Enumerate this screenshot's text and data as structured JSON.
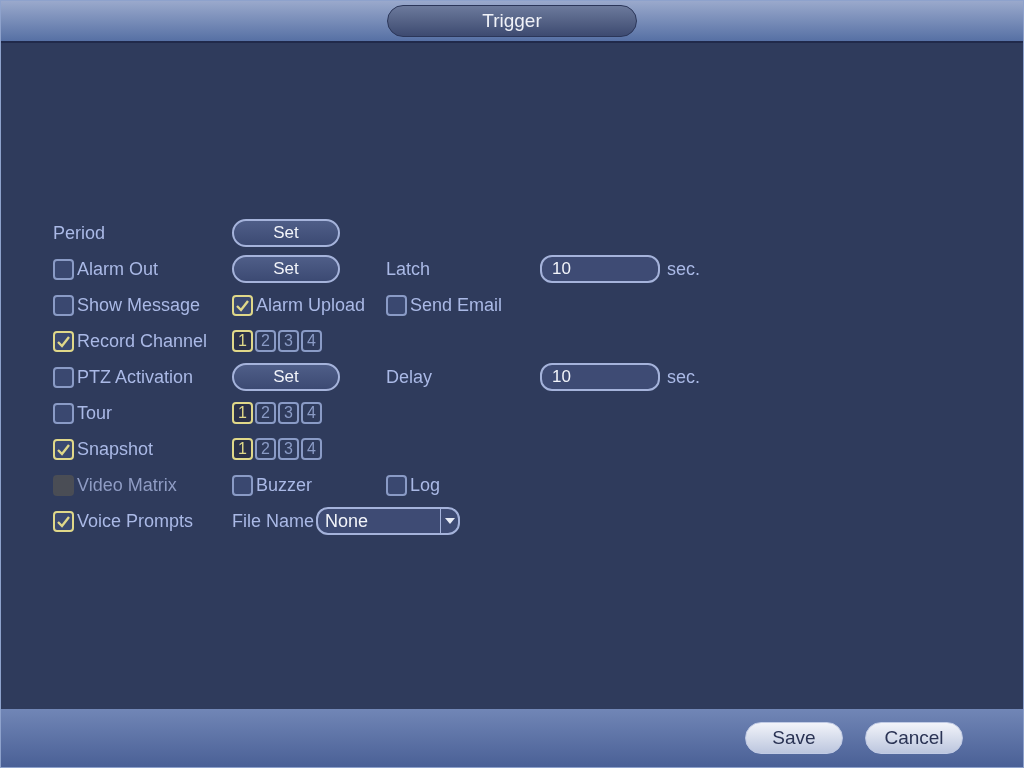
{
  "title": "Trigger",
  "rows": [
    {
      "items": [
        {
          "kind": "label",
          "text": "Period"
        },
        {
          "kind": "button",
          "text": "Set"
        }
      ]
    },
    {
      "items": [
        {
          "kind": "checkbox",
          "text": "Alarm Out",
          "checked": false,
          "disabled": false
        },
        {
          "kind": "button",
          "text": "Set"
        },
        {
          "kind": "label",
          "text": "Latch"
        },
        {
          "kind": "field",
          "value": "10",
          "unit": "sec."
        }
      ]
    },
    {
      "items": [
        {
          "kind": "checkbox",
          "text": "Show Message",
          "checked": false,
          "disabled": false
        },
        {
          "kind": "checkbox",
          "text": "Alarm Upload",
          "checked": true,
          "disabled": false
        },
        {
          "kind": "checkbox",
          "text": "Send Email",
          "checked": false,
          "disabled": false
        }
      ]
    },
    {
      "items": [
        {
          "kind": "checkbox",
          "text": "Record Channel",
          "checked": true,
          "disabled": false
        },
        {
          "kind": "channels",
          "channels": [
            {
              "text": "1",
              "selected": true
            },
            {
              "text": "2",
              "selected": false
            },
            {
              "text": "3",
              "selected": false
            },
            {
              "text": "4",
              "selected": false
            }
          ]
        }
      ]
    },
    {
      "items": [
        {
          "kind": "checkbox",
          "text": "PTZ Activation",
          "checked": false,
          "disabled": false
        },
        {
          "kind": "button",
          "text": "Set"
        },
        {
          "kind": "label",
          "text": "Delay"
        },
        {
          "kind": "field",
          "value": "10",
          "unit": "sec."
        }
      ]
    },
    {
      "items": [
        {
          "kind": "checkbox",
          "text": "Tour",
          "checked": false,
          "disabled": false
        },
        {
          "kind": "channels",
          "channels": [
            {
              "text": "1",
              "selected": true
            },
            {
              "text": "2",
              "selected": false
            },
            {
              "text": "3",
              "selected": false
            },
            {
              "text": "4",
              "selected": false
            }
          ]
        }
      ]
    },
    {
      "items": [
        {
          "kind": "checkbox",
          "text": "Snapshot",
          "checked": true,
          "disabled": false
        },
        {
          "kind": "channels",
          "channels": [
            {
              "text": "1",
              "selected": true
            },
            {
              "text": "2",
              "selected": false
            },
            {
              "text": "3",
              "selected": false
            },
            {
              "text": "4",
              "selected": false
            }
          ]
        }
      ]
    },
    {
      "items": [
        {
          "kind": "checkbox",
          "text": "Video Matrix",
          "checked": false,
          "disabled": true
        },
        {
          "kind": "checkbox",
          "text": "Buzzer",
          "checked": false,
          "disabled": false
        },
        {
          "kind": "checkbox",
          "text": "Log",
          "checked": false,
          "disabled": false
        }
      ]
    },
    {
      "items": [
        {
          "kind": "checkbox",
          "text": "Voice Prompts",
          "checked": true,
          "disabled": false
        },
        {
          "kind": "select",
          "label": "File Name",
          "value": "None"
        }
      ]
    }
  ],
  "buttons": [
    "Save",
    "Cancel"
  ]
}
